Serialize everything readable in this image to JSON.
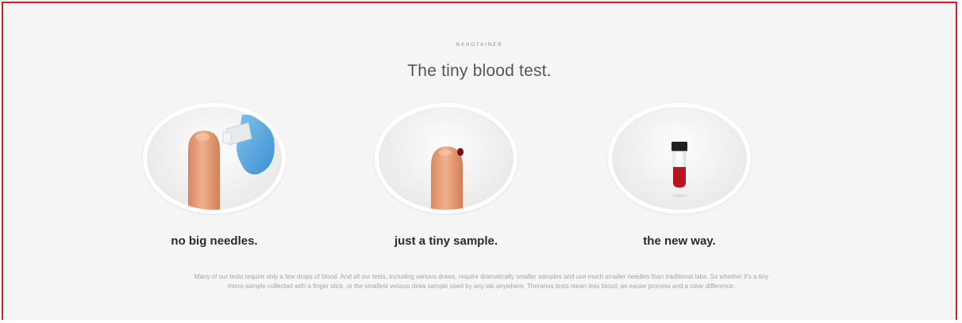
{
  "section": {
    "eyebrow": "NANOTAINER",
    "headline": "The tiny blood test."
  },
  "features": [
    {
      "caption": "no big needles.",
      "illustration": "finger-lancet-icon"
    },
    {
      "caption": "just a tiny sample.",
      "illustration": "finger-blood-drop-icon"
    },
    {
      "caption": "the new way.",
      "illustration": "nanotainer-vial-icon"
    }
  ],
  "body_text": "Many of our tests require only a few drops of blood. And all our tests, including venous draws, require dramatically smaller samples and use much smaller needles than traditional labs. So whether it's a tiny micro-sample collected with a finger stick, or the smallest venous draw sample used by any lab anywhere, Theranos tests mean less blood, an easier process and a clear difference.",
  "colors": {
    "frame_border": "#c0262b",
    "background": "#f5f5f5",
    "finger": "#e8a07a",
    "glove": "#5aa9e0",
    "blood": "#b81420"
  }
}
